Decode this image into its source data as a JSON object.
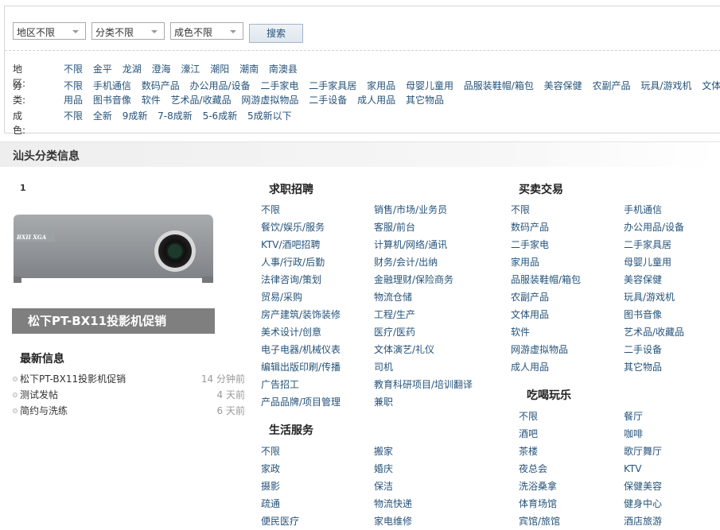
{
  "search": {
    "region_select": "地区不限",
    "category_select": "分类不限",
    "condition_select": "成色不限",
    "button": "搜索"
  },
  "filters": {
    "region": {
      "label": "地区:",
      "options": [
        "不限",
        "金平",
        "龙湖",
        "澄海",
        "濠江",
        "潮阳",
        "潮南",
        "南澳县"
      ]
    },
    "category": {
      "label": "分类:",
      "options": [
        "不限",
        "手机通信",
        "数码产品",
        "办公用品/设备",
        "二手家电",
        "二手家具居",
        "家用品",
        "母婴儿童用",
        "品服装鞋帽/箱包",
        "美容保健",
        "农副产品",
        "玩具/游戏机",
        "文体用品",
        "图书音像",
        "软件",
        "艺术品/收藏品",
        "网游虚拟物品",
        "二手设备",
        "成人用品",
        "其它物品"
      ]
    },
    "condition": {
      "label": "成色:",
      "options": [
        "不限",
        "全新",
        "9成新",
        "7-8成新",
        "5-6成新",
        "5成新以下"
      ]
    }
  },
  "section_title": "汕头分类信息",
  "slideshow": {
    "index": "1",
    "image_badge": "BXII XGA",
    "caption": "松下PT-BX11投影机促销"
  },
  "latest": {
    "title": "最新信息",
    "items": [
      {
        "title": "松下PT-BX11投影机促销",
        "time": "14 分钟前"
      },
      {
        "title": "测试发帖",
        "time": "4 天前"
      },
      {
        "title": "简约与洗练",
        "time": "6 天前"
      }
    ]
  },
  "groups": [
    {
      "title": "求职招聘",
      "items": [
        "不限",
        "销售/市场/业务员",
        "餐饮/娱乐/服务",
        "客服/前台",
        "KTV/酒吧招聘",
        "计算机/网络/通讯",
        "人事/行政/后勤",
        "财务/会计/出纳",
        "法律咨询/策划",
        "金融理财/保险商务",
        "贸易/采购",
        "物流仓储",
        "房产建筑/装饰装修",
        "工程/生产",
        "美术设计/创意",
        "医疗/医药",
        "电子电器/机械仪表",
        "文体演艺/礼仪",
        "编辑出版印刷/传播",
        "司机",
        "广告招工",
        "教育科研项目/培训翻译",
        "产品品牌/项目管理",
        "兼职"
      ]
    },
    {
      "title": "生活服务",
      "items": [
        "不限",
        "搬家",
        "家政",
        "婚庆",
        "摄影",
        "保洁",
        "疏通",
        "物流快递",
        "便民医疗",
        "家电维修"
      ]
    },
    {
      "title": "买卖交易",
      "items": [
        "不限",
        "手机通信",
        "数码产品",
        "办公用品/设备",
        "二手家电",
        "二手家具居",
        "家用品",
        "母婴儿童用",
        "品服装鞋帽/箱包",
        "美容保健",
        "农副产品",
        "玩具/游戏机",
        "文体用品",
        "图书音像",
        "软件",
        "艺术品/收藏品",
        "网游虚拟物品",
        "二手设备",
        "成人用品",
        "其它物品"
      ]
    },
    {
      "title": "吃喝玩乐",
      "items": [
        "不限",
        "餐厅",
        "酒吧",
        "咖啡",
        "茶楼",
        "歌厅舞厅",
        "夜总会",
        "KTV",
        "洗浴桑拿",
        "保健美容",
        "体育场馆",
        "健身中心",
        "宾馆/旅馆",
        "酒店旅游"
      ]
    }
  ]
}
